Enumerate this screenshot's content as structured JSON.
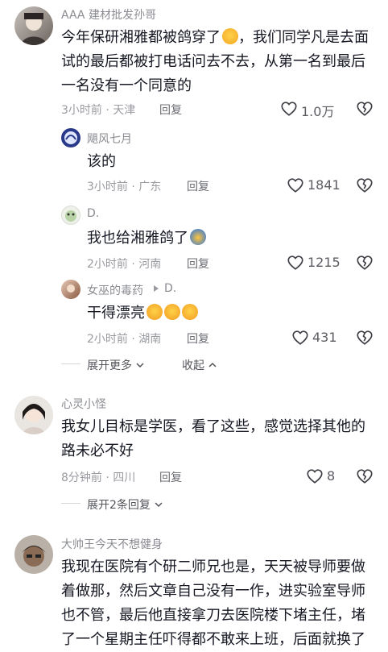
{
  "comments": [
    {
      "name": "AAA 建材批发孙哥",
      "text_lines": [
        "今年保研湘雅都被鸽穿了",
        "，我们同学凡是去面",
        "试的最后都被打电话问去不去，从第一名到最后",
        "一名没有一个同意的"
      ],
      "meta": "3小时前 · 天津",
      "reply": "回复",
      "likes": "1.0万"
    },
    {
      "name": "飓风七月",
      "text": "该的",
      "meta": "3小时前 · 广东",
      "reply": "回复",
      "likes": "1841"
    },
    {
      "name": "D.",
      "text": "我也给湘雅鸽了",
      "meta": "2小时前 · 河南",
      "reply": "回复",
      "likes": "1215"
    },
    {
      "name": "女巫的毒药",
      "reply_to": "D.",
      "text": "干得漂亮",
      "meta": "2小时前 · 湖南",
      "reply": "回复",
      "likes": "431"
    },
    {
      "name": "心灵小怪",
      "text_lines": [
        "我女儿目标是学医，看了这些，感觉选择其他的",
        "路未必不好"
      ],
      "meta": "8分钟前 · 四川",
      "reply": "回复",
      "likes": "8"
    },
    {
      "name": "大帅王今天不想健身",
      "text_lines": [
        "我现在医院有个研二师兄也是，天天被导师要做",
        "着做那，然后文章自己没有一作，进实验室导师",
        "也不管，最后他直接拿刀去医院楼下堵主任，堵",
        "了一个星期主任吓得都不敢来上班，后面就换了"
      ]
    }
  ],
  "expand_more": "展开更多",
  "collapse": "收起",
  "expand_replies": "展开2条回复",
  "icons": [
    "heart-icon",
    "broken-heart-icon",
    "chevron-down-icon",
    "chevron-up-icon"
  ],
  "colors": {
    "text": "#161823",
    "meta": "#9a9ba1",
    "name": "#8a8b91"
  }
}
